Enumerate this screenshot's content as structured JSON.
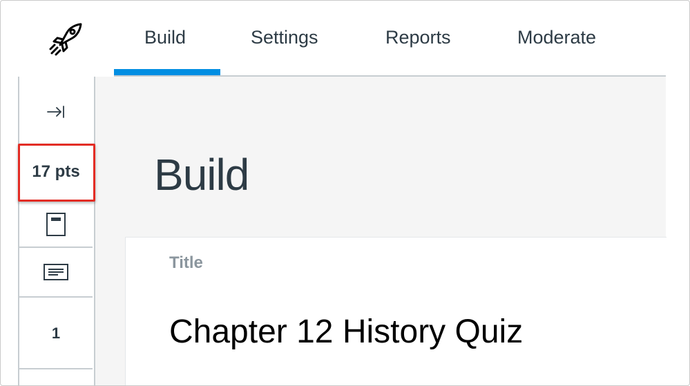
{
  "nav": {
    "logo_icon": "rocket-icon",
    "tabs": [
      {
        "label": "Build",
        "active": true
      },
      {
        "label": "Settings",
        "active": false
      },
      {
        "label": "Reports",
        "active": false
      },
      {
        "label": "Moderate",
        "active": false
      }
    ]
  },
  "colors": {
    "accent": "#008ee2",
    "highlight": "#e32c24",
    "text": "#2d3b45",
    "muted": "#8b969e",
    "main_bg": "#f5f5f5"
  },
  "sidebar": {
    "collapse_icon": "collapse-right-icon",
    "points": "17 pts",
    "items": [
      {
        "icon": "page-icon"
      },
      {
        "icon": "text-block-icon"
      }
    ],
    "question_number": "1"
  },
  "main": {
    "heading": "Build",
    "title_label": "Title",
    "quiz_title": "Chapter 12 History Quiz"
  }
}
